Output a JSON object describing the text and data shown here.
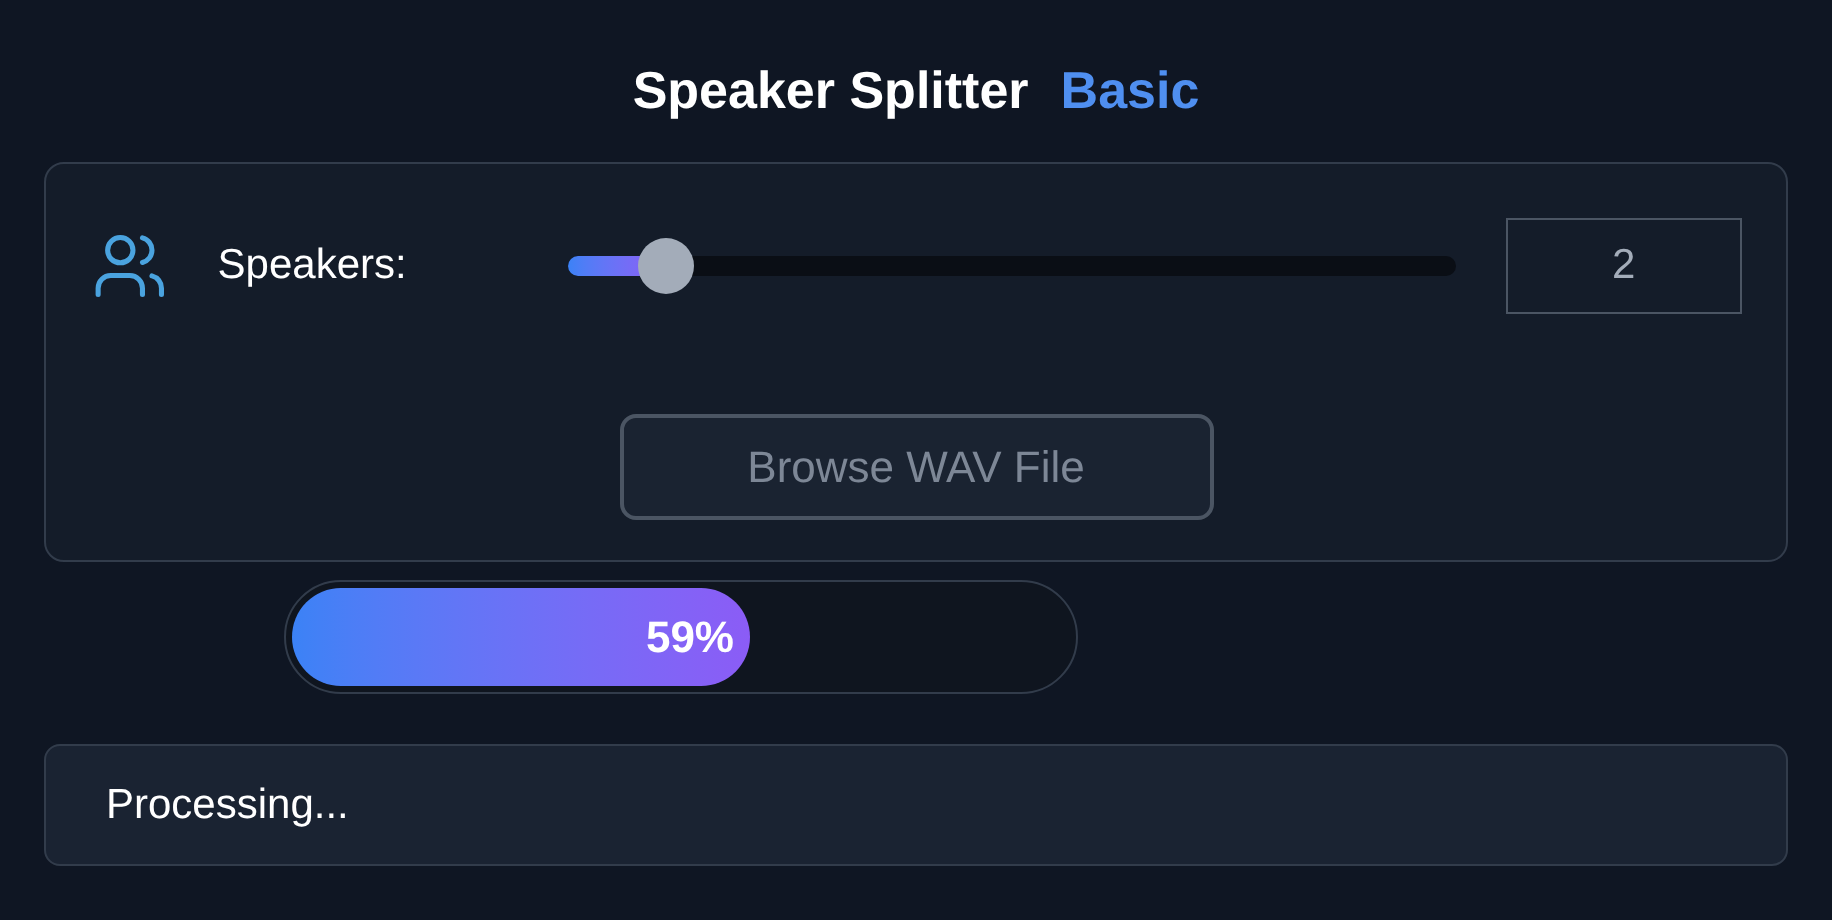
{
  "title": {
    "text": "Speaker Splitter",
    "badge": "Basic"
  },
  "speakers": {
    "label": "Speakers:",
    "level": 0.11,
    "value": "2"
  },
  "browse_button": {
    "label": "Browse WAV File",
    "disabled": true
  },
  "progress": {
    "level": 0.59,
    "reading": "59%"
  },
  "status": {
    "text": "Processing..."
  }
}
